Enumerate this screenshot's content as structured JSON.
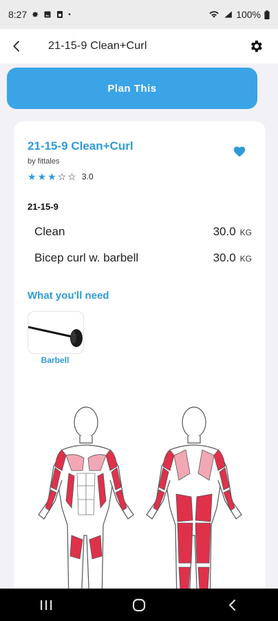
{
  "status_bar": {
    "time": "8:27",
    "battery": "100%",
    "icons": [
      "settings-icon",
      "image-icon",
      "sim-icon",
      "dot-icon",
      "wifi-icon",
      "signal-icon",
      "battery-icon"
    ]
  },
  "app_bar": {
    "title": "21-15-9 Clean+Curl",
    "back_icon": "back-arrow-icon",
    "settings_icon": "gear-icon"
  },
  "plan_button": {
    "label": "Plan This"
  },
  "workout": {
    "title": "21-15-9 Clean+Curl",
    "author": "by fittales",
    "rating": 3.0,
    "rating_label": "3.0",
    "stars_total": 5,
    "favorite": true,
    "scheme": "21-15-9",
    "exercises": [
      {
        "name": "Clean",
        "weight": "30.0",
        "unit": "KG"
      },
      {
        "name": "Bicep curl w. barbell",
        "weight": "30.0",
        "unit": "KG"
      }
    ]
  },
  "equipment": {
    "heading": "What you'll need",
    "items": [
      {
        "name": "Barbell",
        "icon": "barbell-icon"
      }
    ]
  },
  "colors": {
    "accent": "#2f9ad9",
    "button": "#3ba4e6",
    "muscle": "#e0314b",
    "muscle_light": "#f2a8b4"
  },
  "nav_bar": {
    "icons": [
      "recent-apps-icon",
      "home-icon",
      "back-icon"
    ]
  }
}
